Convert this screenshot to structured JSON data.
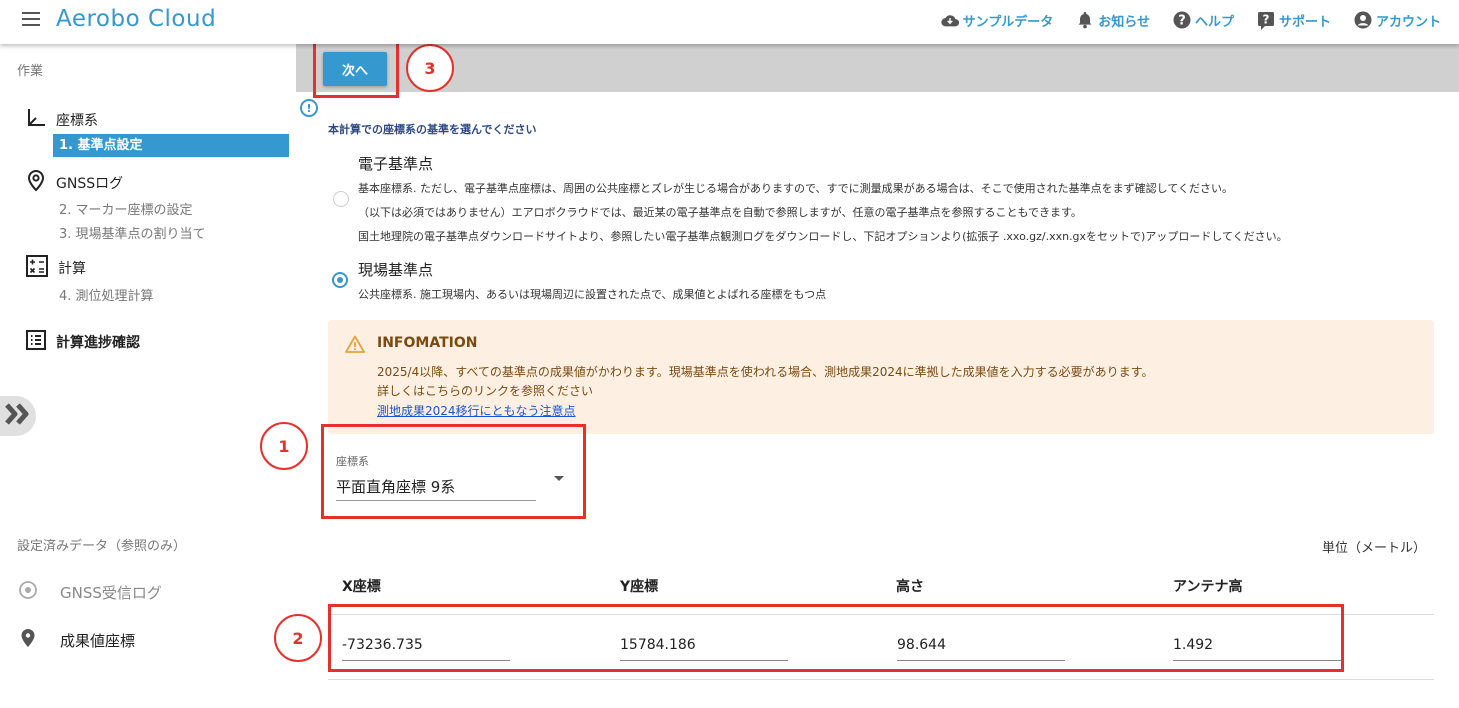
{
  "header": {
    "app_title": "Aerobo Cloud",
    "nav": [
      {
        "label": "サンプルデータ",
        "icon": "cloud-download-icon"
      },
      {
        "label": "お知らせ",
        "icon": "bell-icon"
      },
      {
        "label": "ヘルプ",
        "icon": "help-circle-icon"
      },
      {
        "label": "サポート",
        "icon": "support-icon"
      },
      {
        "label": "アカウント",
        "icon": "account-icon"
      }
    ]
  },
  "sidebar": {
    "work_heading": "作業",
    "sections": [
      {
        "label": "座標系",
        "icon": "axes-icon"
      },
      {
        "label": "GNSSログ",
        "icon": "location-pin-icon"
      },
      {
        "label": "計算",
        "icon": "calculator-icon"
      },
      {
        "label": "計算進捗確認",
        "icon": "list-icon"
      }
    ],
    "steps": {
      "step1": "1. 基準点設定",
      "step2": "2. マーカー座標の設定",
      "step3": "3. 現場基準点の割り当て",
      "step4": "4. 測位処理計算"
    },
    "data_heading": "設定済みデータ（参照のみ）",
    "data_items": [
      {
        "label": "GNSS受信ログ",
        "icon": "radio-target-icon"
      },
      {
        "label": "成果値座標",
        "icon": "map-pin-icon"
      }
    ]
  },
  "toolbar": {
    "next_label": "次へ"
  },
  "annotations": {
    "one": "1",
    "two": "2",
    "three": "3"
  },
  "prompt": "本計算での座標系の基準を選んでください",
  "options": [
    {
      "title": "電子基準点",
      "selected": false,
      "desc": [
        "基本座標系. ただし、電子基準点座標は、周囲の公共座標とズレが生じる場合がありますので、すでに測量成果がある場合は、そこで使用された基準点をまず確認してください。",
        "（以下は必須ではありません）エアロボクラウドでは、最近某の電子基準点を自動で参照しますが、任意の電子基準点を参照することもできます。",
        "国土地理院の電子基準点ダウンロードサイトより、参照したい電子基準点観測ログをダウンロードし、下記オプションより(拡張子 .xxo.gz/.xxn.gxをセットで)アップロードしてください。"
      ]
    },
    {
      "title": "現場基準点",
      "selected": true,
      "desc": [
        "公共座標系. 施工現場内、あるいは現場周辺に設置された点で、成果値とよばれる座標をもつ点"
      ]
    }
  ],
  "notice": {
    "title": "INFOMATION",
    "line1": "2025/4以降、すべての基準点の成果値がかわります。現場基準点を使われる場合、測地成果2024に準拠した成果値を入力する必要があります。",
    "line2": "詳しくはこちらのリンクを参照ください",
    "link": "測地成果2024移行にともなう注意点"
  },
  "coord_select": {
    "label": "座標系",
    "value": "平面直角座標 9系"
  },
  "table": {
    "unit": "単位（メートル）",
    "columns": [
      "X座標",
      "Y座標",
      "高さ",
      "アンテナ高"
    ],
    "values": [
      "-73236.735",
      "15784.186",
      "98.644",
      "1.492"
    ]
  }
}
